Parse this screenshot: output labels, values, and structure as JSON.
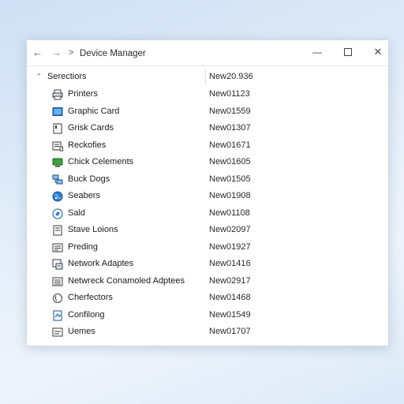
{
  "window": {
    "title": "Device Manager",
    "back_glyph": "←",
    "forward_glyph": "→",
    "crumb_separator": ">",
    "minimize_glyph": "—",
    "close_glyph": "✕"
  },
  "tree": {
    "group": {
      "label": "Serectiors",
      "value": "New20.936",
      "expanded": true
    },
    "items": [
      {
        "name": "Printers",
        "value": "New01123",
        "icon": "printer-icon"
      },
      {
        "name": "Graphic Card",
        "value": "New01559",
        "icon": "display-adapter-icon"
      },
      {
        "name": "Grisk Cards",
        "value": "New01307",
        "icon": "card-icon"
      },
      {
        "name": "Reckofies",
        "value": "New01671",
        "icon": "keyboard-icon"
      },
      {
        "name": "Chick Celements",
        "value": "New01605",
        "icon": "monitor-icon"
      },
      {
        "name": "Buck Dogs",
        "value": "New01505",
        "icon": "network-icon"
      },
      {
        "name": "Seabers",
        "value": "New01908",
        "icon": "globe-icon"
      },
      {
        "name": "Sald",
        "value": "New01108",
        "icon": "sound-icon"
      },
      {
        "name": "Stave Loions",
        "value": "New02097",
        "icon": "storage-icon"
      },
      {
        "name": "Preding",
        "value": "New01927",
        "icon": "processor-icon"
      },
      {
        "name": "Network Adaptes",
        "value": "New01416",
        "icon": "network-adapter-icon"
      },
      {
        "name": "Netwreck Conamoled Adptees",
        "value": "New02917",
        "icon": "controller-icon"
      },
      {
        "name": "Cherfectors",
        "value": "New01468",
        "icon": "sensor-icon"
      },
      {
        "name": "Confilong",
        "value": "New01549",
        "icon": "config-icon"
      },
      {
        "name": "Uemes",
        "value": "New01707",
        "icon": "hid-icon"
      }
    ]
  },
  "colors": {
    "icon_accent": "#1f6fb8",
    "icon_green": "#3a9a3a",
    "icon_dark": "#3a3a3a"
  }
}
